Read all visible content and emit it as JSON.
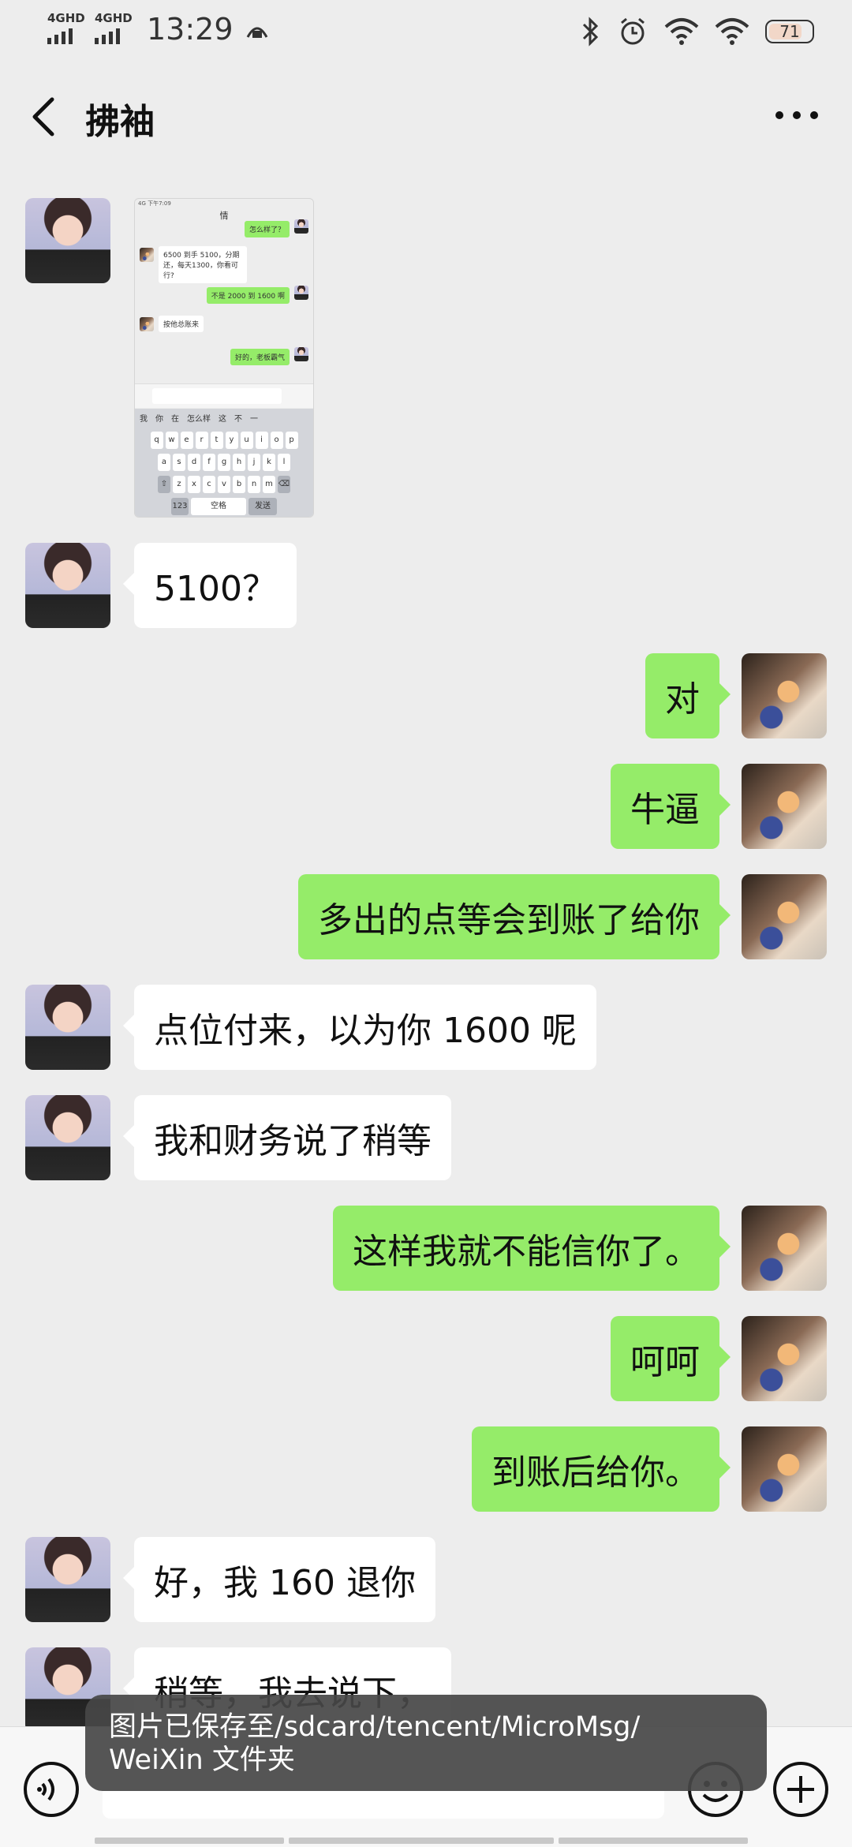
{
  "status_bar": {
    "network_1": "4GHD",
    "network_2": "4GHD",
    "time": "13:29",
    "battery": "71"
  },
  "header": {
    "title": "拂袖"
  },
  "image_message": {
    "sender": "contact",
    "thumbnail": {
      "header_title": "情",
      "top_out": "怎么样了？",
      "msg_in_1": "6500 到手 5100，分期还，每天1300，你看可行?",
      "msg_out_1": "不是 2000 到 1600 啊",
      "msg_in_2": "按他总账来",
      "msg_out_2": "好的，老板霸气",
      "candidates": [
        "我",
        "你",
        "在",
        "怎么样",
        "这",
        "不",
        "一"
      ],
      "row1": [
        "q",
        "w",
        "e",
        "r",
        "t",
        "y",
        "u",
        "i",
        "o",
        "p"
      ],
      "row2": [
        "a",
        "s",
        "d",
        "f",
        "g",
        "h",
        "j",
        "k",
        "l"
      ],
      "row3": [
        "z",
        "x",
        "c",
        "v",
        "b",
        "n",
        "m"
      ],
      "key_123": "123",
      "key_space": "空格",
      "key_send": "发送"
    }
  },
  "messages": [
    {
      "dir": "in",
      "text": "5100？"
    },
    {
      "dir": "out",
      "text": "对"
    },
    {
      "dir": "out",
      "text": "牛逼"
    },
    {
      "dir": "out",
      "text": "多出的点等会到账了给你"
    },
    {
      "dir": "in",
      "text": "点位付来，以为你 1600 呢"
    },
    {
      "dir": "in",
      "text": "我和财务说了稍等"
    },
    {
      "dir": "out",
      "text": "这样我就不能信你了。"
    },
    {
      "dir": "out",
      "text": "呵呵"
    },
    {
      "dir": "out",
      "text": "到账后给你。"
    },
    {
      "dir": "in",
      "text": "好，我 160 退你"
    },
    {
      "dir": "in",
      "text": "稍等，我去说下，"
    }
  ],
  "toast": {
    "text": "图片已保存至/sdcard/tencent/MicroMsg/ WeiXin 文件夹"
  },
  "icons": {
    "back": "back-arrow-icon",
    "more": "more-dots-icon",
    "voice": "voice-icon",
    "emoji": "emoji-icon",
    "plus": "plus-icon",
    "bluetooth": "bluetooth-icon",
    "alarm": "alarm-icon",
    "wifi": "wifi-icon"
  },
  "colors": {
    "background": "#ededed",
    "bubble_out": "#95ec69",
    "bubble_in": "#ffffff",
    "toast": "#464646"
  }
}
